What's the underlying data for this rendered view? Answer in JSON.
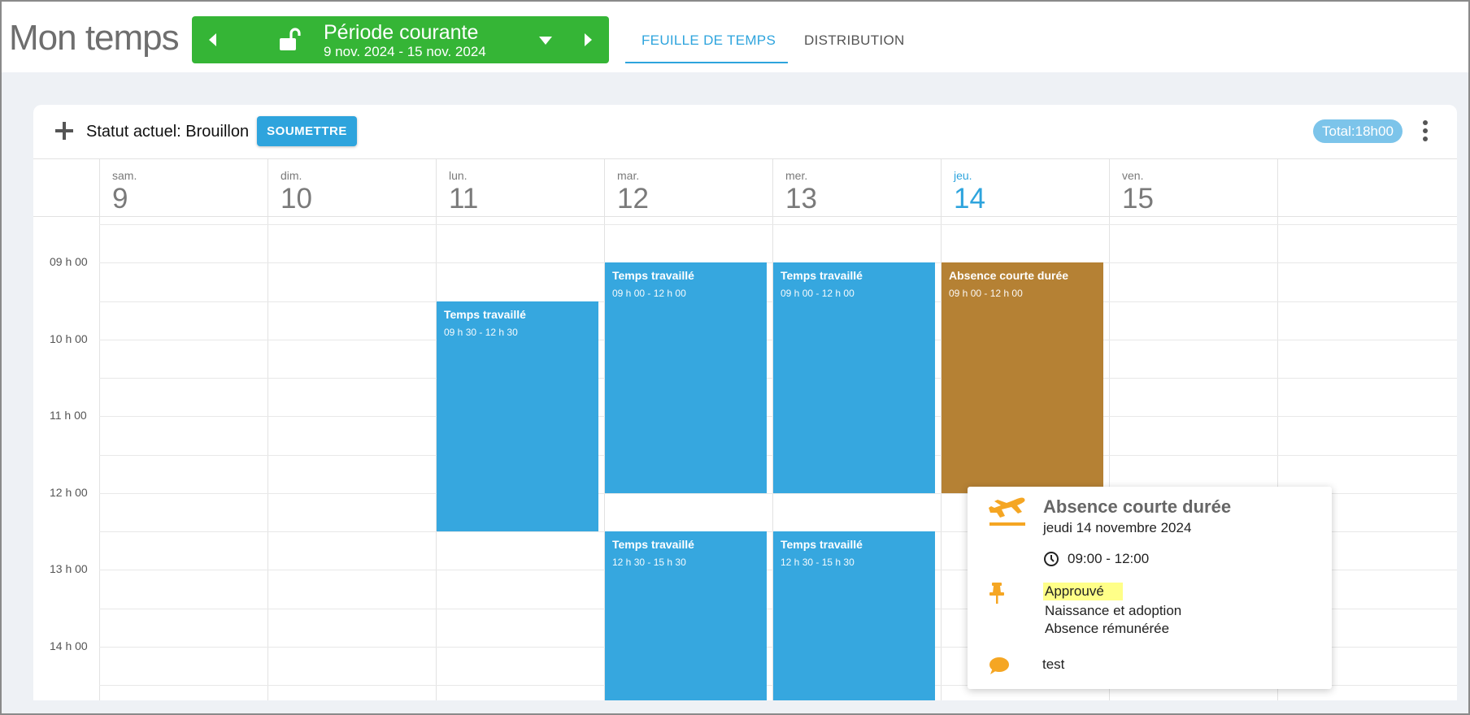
{
  "app": {
    "title": "Mon temps"
  },
  "period": {
    "title": "Période courante",
    "range": "9 nov. 2024 - 15 nov. 2024"
  },
  "tabs": [
    {
      "label": "FEUILLE DE TEMPS",
      "active": true
    },
    {
      "label": "DISTRIBUTION",
      "active": false
    }
  ],
  "toolbar": {
    "status": "Statut actuel: Brouillon",
    "submit_label": "SOUMETTRE",
    "total": "Total:18h00"
  },
  "days": [
    {
      "dow": "sam.",
      "num": "9",
      "today": false
    },
    {
      "dow": "dim.",
      "num": "10",
      "today": false
    },
    {
      "dow": "lun.",
      "num": "11",
      "today": false
    },
    {
      "dow": "mar.",
      "num": "12",
      "today": false
    },
    {
      "dow": "mer.",
      "num": "13",
      "today": false
    },
    {
      "dow": "jeu.",
      "num": "14",
      "today": true
    },
    {
      "dow": "ven.",
      "num": "15",
      "today": false
    }
  ],
  "times": [
    "09 h 00",
    "10 h 00",
    "11 h 00",
    "12 h 00",
    "13 h 00",
    "14 h 00"
  ],
  "events": [
    {
      "day": 2,
      "title": "Temps travaillé",
      "time": "09 h 30 - 12 h 30",
      "start": 9.5,
      "end": 12.5,
      "kind": "blue"
    },
    {
      "day": 3,
      "title": "Temps travaillé",
      "time": "09 h 00 - 12 h 00",
      "start": 9.0,
      "end": 12.0,
      "kind": "blue"
    },
    {
      "day": 4,
      "title": "Temps travaillé",
      "time": "09 h 00 - 12 h 00",
      "start": 9.0,
      "end": 12.0,
      "kind": "blue"
    },
    {
      "day": 5,
      "title": "Absence courte durée",
      "time": "09 h 00 - 12 h 00",
      "start": 9.0,
      "end": 12.0,
      "kind": "brown"
    },
    {
      "day": 3,
      "title": "Temps travaillé",
      "time": "12 h 30 - 15 h 30",
      "start": 12.5,
      "end": 15.5,
      "kind": "blue"
    },
    {
      "day": 4,
      "title": "Temps travaillé",
      "time": "12 h 30 - 15 h 30",
      "start": 12.5,
      "end": 15.5,
      "kind": "blue"
    }
  ],
  "popup": {
    "title": "Absence courte durée",
    "date": "jeudi 14 novembre 2024",
    "time": "09:00 - 12:00",
    "status": "Approuvé",
    "type": "Naissance et adoption",
    "paid": "Absence rémunérée",
    "comment": "test"
  },
  "colors": {
    "period_green": "#35b536",
    "accent_blue": "#2ea4dd",
    "event_blue": "#36a7df",
    "absence_brown": "#b58134",
    "popup_icon_orange": "#f5a623",
    "status_highlight": "#ffff88",
    "total_badge": "#7cc4ea"
  },
  "icons": [
    "chevron-left-icon",
    "unlock-icon",
    "caret-down-icon",
    "chevron-right-icon",
    "plus-icon",
    "kebab-icon",
    "airplane-icon",
    "clock-icon",
    "pushpin-icon",
    "comment-icon"
  ]
}
